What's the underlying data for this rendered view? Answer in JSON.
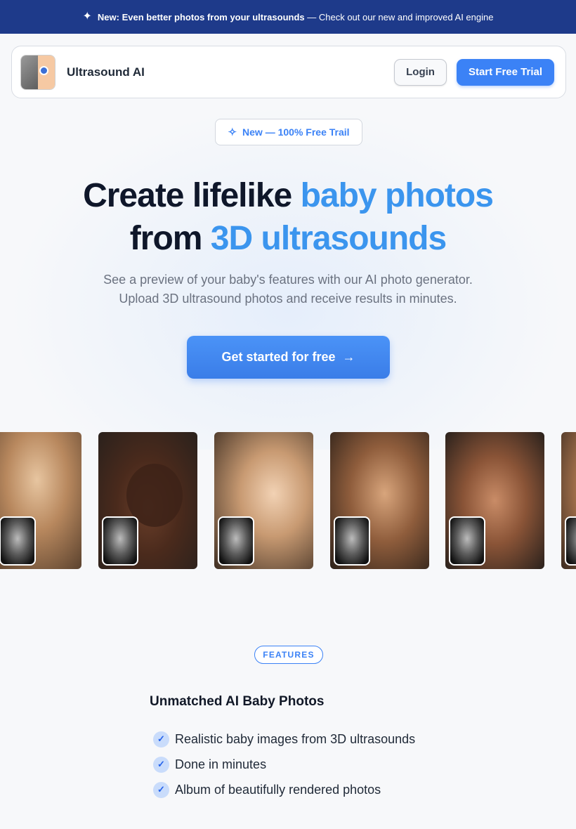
{
  "announcement": {
    "icon": "sparkle-icon",
    "bold": "New: Even better photos from your ultrasounds",
    "rest": "— Check out our new and improved AI engine"
  },
  "nav": {
    "brand": "Ultrasound AI",
    "login": "Login",
    "trial": "Start Free Trial"
  },
  "hero": {
    "pill": "New — 100% Free Trail",
    "title_a": "Create lifelike ",
    "title_b": "baby photos",
    "title_c": "from ",
    "title_d": "3D ultrasounds",
    "subtitle_line1": "See a preview of your baby's features with our AI photo generator.",
    "subtitle_line2": "Upload 3D ultrasound photos and receive results in minutes.",
    "cta": "Get started for free",
    "cta_icon": "arrow-right-icon"
  },
  "features": {
    "badge": "FEATURES",
    "title": "Unmatched AI Baby Photos",
    "items": [
      "Realistic baby images from 3D ultrasounds",
      "Done in minutes",
      "Album of beautifully rendered photos"
    ]
  },
  "colors": {
    "accent": "#3b82f6",
    "announcement_bg": "#1e3a8a",
    "highlight": "#3b95ee"
  }
}
